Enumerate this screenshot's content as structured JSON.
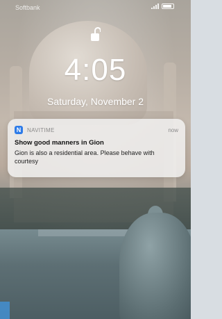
{
  "status_bar": {
    "carrier": "Softbank"
  },
  "lockscreen": {
    "time": "4:05",
    "date": "Saturday, November 2"
  },
  "notification": {
    "app_name": "NAVITIME",
    "when": "now",
    "title": "Show good manners in Gion",
    "body": "Gion is also a residential area. Please behave with courtesy"
  },
  "icons": {
    "unlock": "unlocked-padlock-icon",
    "app": "navitime-app-icon",
    "signal": "signal-icon",
    "battery": "battery-icon"
  },
  "colors": {
    "accent": "#2d7be8"
  }
}
